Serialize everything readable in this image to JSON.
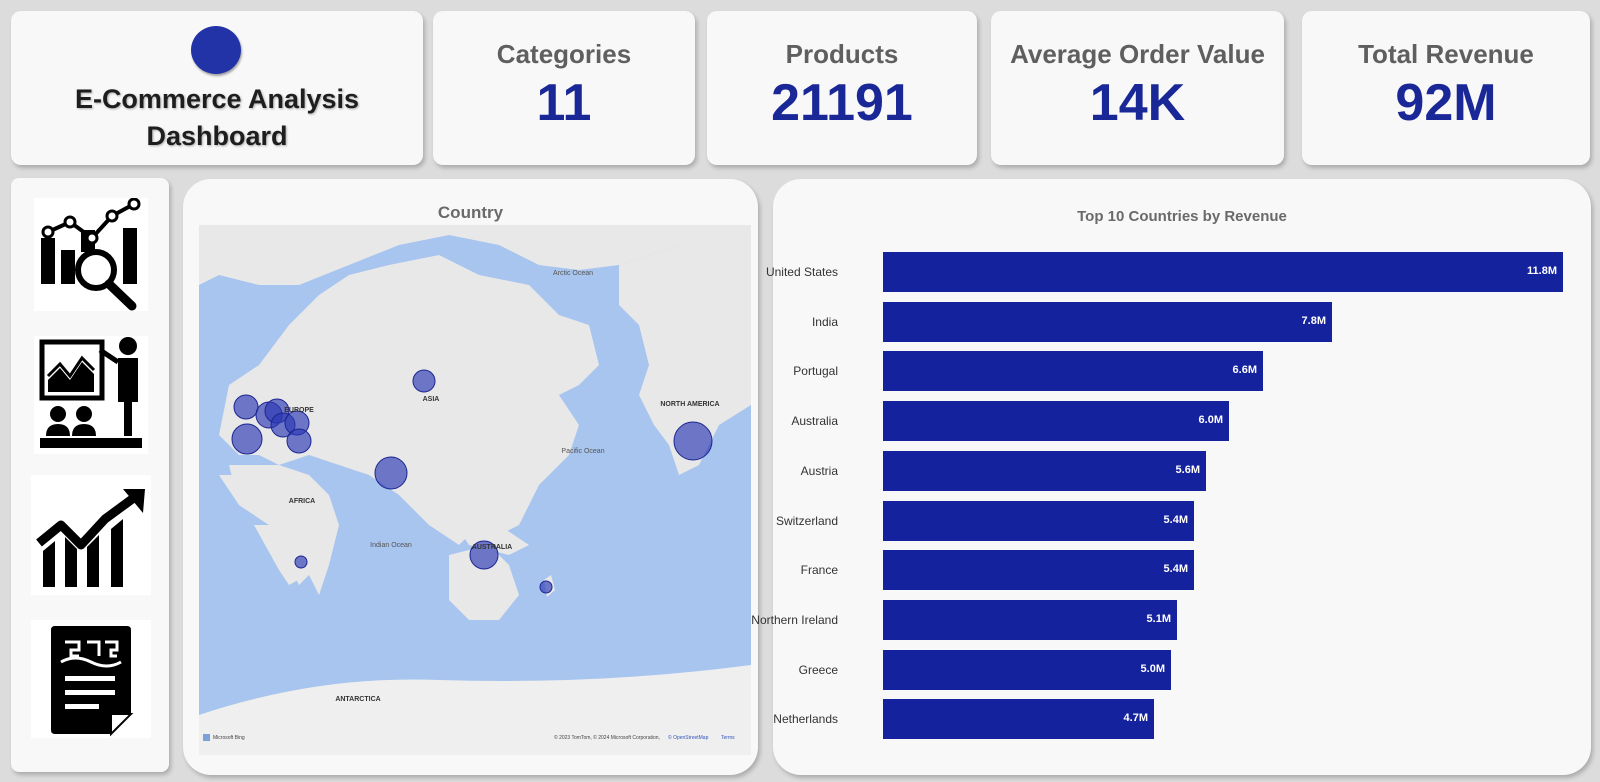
{
  "header": {
    "title_line1": "E-Commerce Analysis",
    "title_line2": "Dashboard"
  },
  "kpis": [
    {
      "label": "Categories",
      "value": "11"
    },
    {
      "label": "Products",
      "value": "21191"
    },
    {
      "label": "Average Order Value",
      "value": "14K"
    },
    {
      "label": "Total Revenue",
      "value": "92M"
    }
  ],
  "nav_icons": [
    "analytics-search-icon",
    "presentation-icon",
    "growth-chart-icon",
    "report-document-icon"
  ],
  "map": {
    "title": "Country",
    "labels": {
      "arctic": "Arctic Ocean",
      "asia": "ASIA",
      "europe": "EUROPE",
      "north_america": "NORTH AMERICA",
      "pacific": "Pacific Ocean",
      "africa": "AFRICA",
      "indian": "Indian Ocean",
      "australia": "AUSTRALIA",
      "antarctica": "ANTARCTICA"
    },
    "brand": "Microsoft Bing",
    "attribution": "© 2023 TomTom, © 2024 Microsoft Corporation,",
    "attribution_link": "© OpenStreetMap",
    "terms": "Terms"
  },
  "chart_data": {
    "type": "bar",
    "orientation": "horizontal",
    "title": "Top 10 Countries by Revenue",
    "categories": [
      "United States",
      "India",
      "Portugal",
      "Australia",
      "Austria",
      "Switzerland",
      "France",
      "Northern Ireland",
      "Greece",
      "Netherlands"
    ],
    "values": [
      11.8,
      7.8,
      6.6,
      6.0,
      5.6,
      5.4,
      5.4,
      5.1,
      5.0,
      4.7
    ],
    "labels": [
      "11.8M",
      "7.8M",
      "6.6M",
      "6.0M",
      "5.6M",
      "5.4M",
      "5.4M",
      "5.1M",
      "5.0M",
      "4.7M"
    ],
    "unit": "M",
    "bar_color": "#15229e",
    "grid": false
  },
  "colors": {
    "accent": "#1a2897",
    "bar": "#15229e",
    "bubble": "#2b37b4"
  }
}
